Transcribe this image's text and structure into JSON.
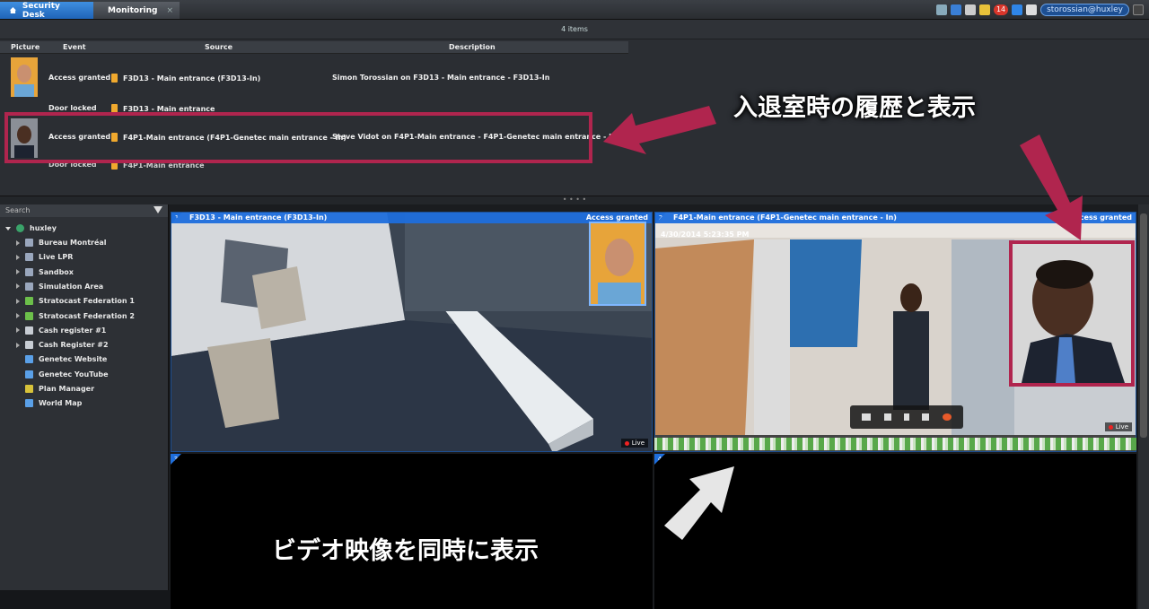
{
  "tabs": [
    {
      "label": "Security Desk"
    },
    {
      "label": "Monitoring",
      "close": "×"
    }
  ],
  "tray": {
    "notification_count": "14",
    "user": "storossian@huxley"
  },
  "events": {
    "count_label": "4 items",
    "columns": [
      "Picture",
      "Event",
      "Source",
      "Description"
    ],
    "rows": [
      {
        "event": "Access granted",
        "source": "F3D13 - Main entrance (F3D13-In)",
        "description": "Simon Torossian on F3D13 - Main entrance - F3D13-In"
      },
      {
        "event": "Door locked",
        "source": "F3D13 - Main entrance",
        "description": ""
      },
      {
        "event": "Access granted",
        "source": "F4P1-Main entrance (F4P1-Genetec main entrance - In)",
        "description": "Steve Vidot on F4P1-Main entrance - F4P1-Genetec main entrance - In"
      },
      {
        "event": "Door locked",
        "source": "F4P1-Main entrance",
        "description": ""
      }
    ]
  },
  "annotations": {
    "history": "入退室時の履歴と表示",
    "video": "ビデオ映像を同時に表示"
  },
  "tree": {
    "search_placeholder": "Search",
    "root": "huxley",
    "items": [
      {
        "label": "Bureau Montréal",
        "icon": "server-icon"
      },
      {
        "label": "Live LPR",
        "icon": "server-icon"
      },
      {
        "label": "Sandbox",
        "icon": "server-icon"
      },
      {
        "label": "Simulation Area",
        "icon": "server-icon"
      },
      {
        "label": "Stratocast Federation 1",
        "icon": "federation-icon"
      },
      {
        "label": "Stratocast Federation 2",
        "icon": "federation-icon"
      },
      {
        "label": "Cash register #1",
        "icon": "register-icon"
      },
      {
        "label": "Cash Register #2",
        "icon": "register-icon"
      },
      {
        "label": "Genetec Website",
        "icon": "web-icon"
      },
      {
        "label": "Genetec YouTube",
        "icon": "web-icon"
      },
      {
        "label": "Plan Manager",
        "icon": "plan-icon"
      },
      {
        "label": "World Map",
        "icon": "web-icon"
      }
    ]
  },
  "tiles": {
    "t1": {
      "num": "1",
      "title": "F3D13 - Main entrance (F3D13-In)",
      "status": "Access granted",
      "live": "Live"
    },
    "t2": {
      "num": "2",
      "title": "F4P1-Main entrance (F4P1-Genetec main entrance - In)",
      "status": "Access granted",
      "timestamp": "4/30/2014 5:23:35 PM",
      "live": "Live"
    },
    "t3": {
      "num": "3"
    },
    "t4": {
      "num": "4"
    }
  },
  "grip": "• • • •"
}
